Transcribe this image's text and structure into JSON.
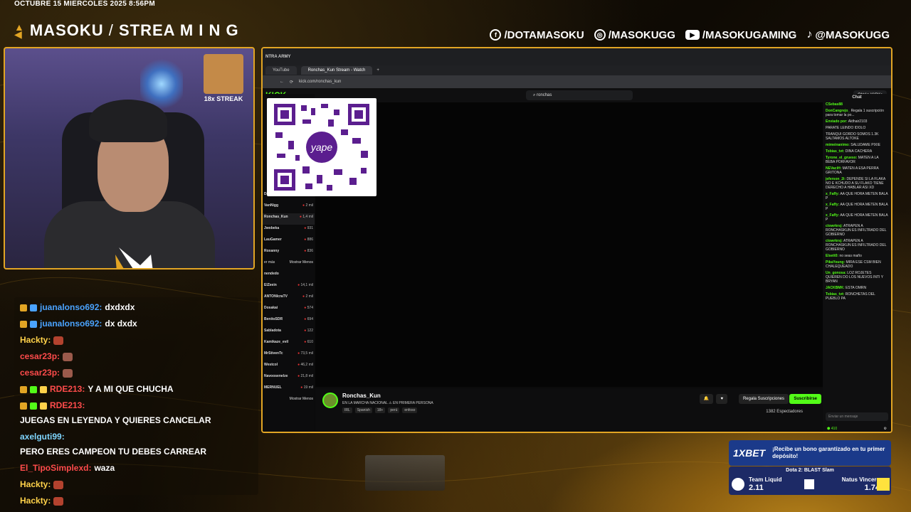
{
  "date": "OCTUBRE 15 MIERCOLES 2025 8:56PM",
  "brand": {
    "name": "MASOKU",
    "suffix": "STREA M I N G"
  },
  "socials": [
    {
      "icon": "facebook-icon",
      "label": "/DOTAMASOKU"
    },
    {
      "icon": "instagram-icon",
      "label": "/MASOKUGG"
    },
    {
      "icon": "youtube-icon",
      "label": "/MASOKUGAMING"
    },
    {
      "icon": "tiktok-icon",
      "label": "@MASOKUGG"
    }
  ],
  "webcam": {
    "streak_label": "18x STREAK"
  },
  "chat": [
    {
      "user": "juanalonso692:",
      "user_color": "#4aa3ff",
      "text": "dxdxdx"
    },
    {
      "user": "juanalonso692:",
      "user_color": "#4aa3ff",
      "text": "dx dxdx"
    },
    {
      "user": "Hackty:",
      "user_color": "#ffd24a",
      "text": ""
    },
    {
      "user": "cesar23p:",
      "user_color": "#ff4b4b",
      "text": ""
    },
    {
      "user": "cesar23p:",
      "user_color": "#ff4b4b",
      "text": ""
    },
    {
      "user": "RDE213:",
      "user_color": "#ff4b4b",
      "text": "Y A MI QUE CHUCHA"
    },
    {
      "user": "RDE213:",
      "user_color": "#ff4b4b",
      "text": "JUEGAS EN LEYENDA Y QUIERES CANCELAR"
    },
    {
      "user": "axelguti99:",
      "user_color": "#7fd6ff",
      "text": "PERO ERES CAMPEON TU DEBES CARREAR"
    },
    {
      "user": "El_TipoSimplexd:",
      "user_color": "#ff4b4b",
      "text": "waza"
    },
    {
      "user": "Hackty:",
      "user_color": "#ffd24a",
      "text": ""
    },
    {
      "user": "Hackty:",
      "user_color": "#ffd24a",
      "text": ""
    }
  ],
  "browser": {
    "tabs": [
      "YouTube",
      "Ronchas_Kun Stream - Watch"
    ],
    "address": "kick.com/ronchas_kun",
    "kick_logo": "KICK",
    "search_value": "ronchas",
    "cta": "Obtén KICKs",
    "sidebar_top": "NTRA ARMY",
    "sidebar": [
      {
        "name": "Daarick",
        "sub": "Conversando",
        "viewers": "2,5 mil"
      },
      {
        "name": "VanNigg",
        "sub": "Dota 2",
        "viewers": "2 mil"
      },
      {
        "name": "Ronchas_Kun",
        "sub": "IRL",
        "viewers": "1,4 mil"
      },
      {
        "name": "Jwobeka",
        "sub": "Dota 2",
        "viewers": "931"
      },
      {
        "name": "LauGamer",
        "sub": "Resident Evil 4",
        "viewers": "886"
      },
      {
        "name": "Roxanny",
        "sub": "Conversando",
        "viewers": "836"
      },
      {
        "name": "nendedo",
        "sub": "",
        "viewers": ""
      },
      {
        "name": "ElZeein",
        "sub": "Conversando",
        "viewers": "14,1 mil"
      },
      {
        "name": "ANTONIcraTV",
        "sub": "Left 4 Dead 2",
        "viewers": "2 mil"
      },
      {
        "name": "Dosakai",
        "sub": "Slots & Casino",
        "viewers": "574"
      },
      {
        "name": "BenitoSDR",
        "sub": "Conversando",
        "viewers": "694"
      },
      {
        "name": "Sabladota",
        "sub": "Dota 2",
        "viewers": "122"
      },
      {
        "name": "Kamikaze_evil",
        "sub": "Slots & Casino",
        "viewers": "610"
      },
      {
        "name": "MrStivenTc",
        "sub": "IRL",
        "viewers": "73,5 mil"
      },
      {
        "name": "Westcol",
        "sub": "IRL",
        "viewers": "46,2 mil"
      },
      {
        "name": "Navoosenelze",
        "sub": "IRL",
        "viewers": "21,8 mil"
      },
      {
        "name": "MERNUEL",
        "sub": "Conversando",
        "viewers": "19 mil"
      }
    ],
    "sidebar_more_1": "Mostrar Menos",
    "sidebar_more_1_prefix": "er más",
    "sidebar_more_2": "Mostrar Menos",
    "qr_brand": "yape",
    "stream": {
      "name": "Ronchas_Kun",
      "title": "EN LA MARCHA NACIONAL ⚠ EN PRIMERA PERSONA",
      "tags": [
        "IRL",
        "Spanish",
        "18+",
        "perú",
        "enfoso"
      ],
      "gift_label": "Regala Suscripciones",
      "subscribe_label": "Suscribirse",
      "viewers": "1382 Espectadores"
    },
    "kick_chat": {
      "title": "Chat",
      "messages": [
        {
          "user": "CSebas88",
          "text": ""
        },
        {
          "user": "DonCangrejo_",
          "text": "Regala 1 suscripción para tomar la po..."
        },
        {
          "user": "Enviado por:",
          "text": "Aldhair2103"
        },
        {
          "user": "",
          "text": "PARATE LEINDO IDOLO"
        },
        {
          "user": "",
          "text": "TRANQUI GORDO SOMOS 1.3K SALTAMOS ALTOKE"
        },
        {
          "user": "mimeinanimo:",
          "text": "SALUDAME PIXIE"
        },
        {
          "user": "Tobias_tvt:",
          "text": "DINA CACHERA"
        },
        {
          "user": "Tyrone_el_grueso:",
          "text": "MATEN A LA BEBA PORFAVOR"
        },
        {
          "user": "NEVaciH:",
          "text": "MATEN A ESA PERRA GRITONA"
        },
        {
          "user": "jeferson_2i:",
          "text": "DEPENDE SI LA FLAKA NO E KCHUDO A SU FLAKO TIENE DERECHO A HABLAR ASI XD"
        },
        {
          "user": "x_Faffy:",
          "text": "AA QUE HORA METEN BALA P"
        },
        {
          "user": "x_Faffy:",
          "text": "AA QUE HORA METEN BALA P"
        },
        {
          "user": "x_Faffy:",
          "text": "AA QUE HORA METEN BALA P"
        },
        {
          "user": "ctowrkrsj:",
          "text": "ATRAPEN A RONCHASKUN ES INFILTRADO DEL GOBIERNO"
        },
        {
          "user": "ctowrkrsj:",
          "text": "ATRAPEN A RONCHASKUN ES INFILTRADO DEL GOBIERNO"
        },
        {
          "user": "Elsett0:",
          "text": "no seas maño"
        },
        {
          "user": "PikaYoung:",
          "text": "MIRA ESE CSM BIEN CHALEQUEADO"
        },
        {
          "user": "Un_gonosa:",
          "text": "LOZ ROJETES QUIEREN DO LOS NUEVOS INTI Y BRYAN"
        },
        {
          "user": "JACKBMK:",
          "text": "ESTA OMRN"
        },
        {
          "user": "Tobias_tvt:",
          "text": "RONCHETAS DEL PUEBLO PA"
        }
      ],
      "input_placeholder": "Enviar un mensaje",
      "points": "410"
    }
  },
  "promo": {
    "logo": "1XBET",
    "text": "¡Recibe un bono garantizado en tu primer depósito!"
  },
  "match": {
    "title": "Dota 2: BLAST Slam",
    "team_a": "Team Liquid",
    "odds_a": "2.11",
    "team_b": "Natus Vincere",
    "odds_b": "1.74"
  },
  "colors": {
    "accent": "#e2a524",
    "kick_green": "#53fc18"
  }
}
